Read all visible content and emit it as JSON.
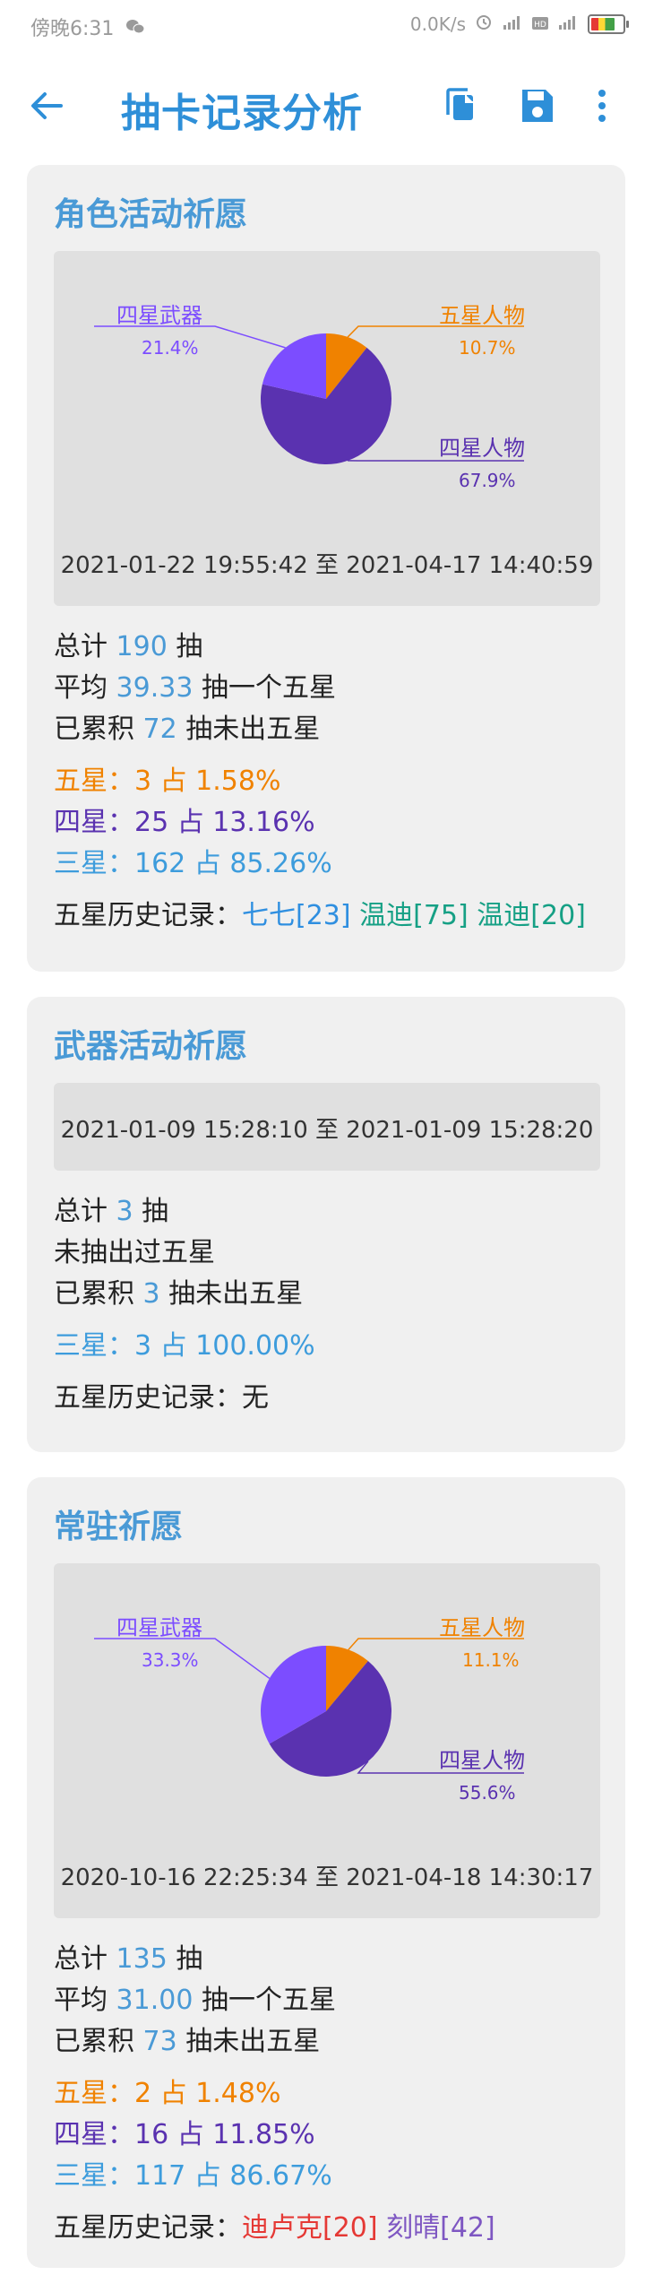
{
  "status_bar": {
    "time": "傍晚6:31",
    "speed": "0.0K/s",
    "icons": [
      "wechat-icon",
      "alarm-icon",
      "signal-icon",
      "hd-icon",
      "signal-icon",
      "battery-icon"
    ]
  },
  "app_bar": {
    "title": "抽卡记录分析",
    "icons": [
      "back-arrow-icon",
      "copy-icon",
      "save-icon",
      "more-vert-icon"
    ]
  },
  "colors": {
    "five_star": "#f08200",
    "four_star_char": "#5a32b0",
    "four_star_weapon": "#7c4dff",
    "three_star": "#3d9cdc",
    "accent": "#2e8fd8"
  },
  "sections": [
    {
      "title": "角色活动祈愿",
      "has_chart": true,
      "chart_data": {
        "type": "pie",
        "slices": [
          {
            "label": "五星人物",
            "value": 10.7,
            "pct": "10.7%",
            "color": "#f08200"
          },
          {
            "label": "四星人物",
            "value": 67.9,
            "pct": "67.9%",
            "color": "#5a32b0"
          },
          {
            "label": "四星武器",
            "value": 21.4,
            "pct": "21.4%",
            "color": "#7c4dff"
          }
        ]
      },
      "date_range": "2021-01-22 19:55:42  至  2021-04-17 14:40:59",
      "total": {
        "prefix": "总计 ",
        "value": "190",
        "suffix": " 抽"
      },
      "avg": {
        "prefix": "平均 ",
        "value": "39.33",
        "suffix": " 抽一个五星"
      },
      "accum": {
        "prefix": "已累积 ",
        "value": "72",
        "suffix": " 抽未出五星"
      },
      "stars": [
        {
          "kind": "five",
          "text": "五星：3 占 1.58%"
        },
        {
          "kind": "four",
          "text": "四星：25 占 13.16%"
        },
        {
          "kind": "three",
          "text": "三星：162 占 85.26%"
        }
      ],
      "history_label": "五星历史记录：",
      "history": [
        {
          "text": "七七[23]",
          "color": "h1"
        },
        {
          "text": "温迪[75]",
          "color": "h2"
        },
        {
          "text": "温迪[20]",
          "color": "h2"
        }
      ]
    },
    {
      "title": "武器活动祈愿",
      "has_chart": false,
      "date_range": "2021-01-09 15:28:10  至  2021-01-09 15:28:20",
      "total": {
        "prefix": "总计 ",
        "value": "3",
        "suffix": " 抽"
      },
      "no_five": "未抽出过五星",
      "accum": {
        "prefix": "已累积 ",
        "value": "3",
        "suffix": " 抽未出五星"
      },
      "stars": [
        {
          "kind": "three",
          "text": "三星：3 占 100.00%"
        }
      ],
      "history_text": "五星历史记录：无"
    },
    {
      "title": "常驻祈愿",
      "has_chart": true,
      "chart_data": {
        "type": "pie",
        "slices": [
          {
            "label": "五星人物",
            "value": 11.1,
            "pct": "11.1%",
            "color": "#f08200"
          },
          {
            "label": "四星人物",
            "value": 55.6,
            "pct": "55.6%",
            "color": "#5a32b0"
          },
          {
            "label": "四星武器",
            "value": 33.3,
            "pct": "33.3%",
            "color": "#7c4dff"
          }
        ]
      },
      "date_range": "2020-10-16 22:25:34  至  2021-04-18 14:30:17",
      "total": {
        "prefix": "总计 ",
        "value": "135",
        "suffix": " 抽"
      },
      "avg": {
        "prefix": "平均 ",
        "value": "31.00",
        "suffix": " 抽一个五星"
      },
      "accum": {
        "prefix": "已累积 ",
        "value": "73",
        "suffix": " 抽未出五星"
      },
      "stars": [
        {
          "kind": "five",
          "text": "五星：2 占 1.48%"
        },
        {
          "kind": "four",
          "text": "四星：16 占 11.85%"
        },
        {
          "kind": "three",
          "text": "三星：117 占 86.67%"
        }
      ],
      "history_label": "五星历史记录：",
      "history": [
        {
          "text": "迪卢克[20]",
          "color": "h3"
        },
        {
          "text": "刻晴[42]",
          "color": "h4"
        }
      ]
    }
  ]
}
